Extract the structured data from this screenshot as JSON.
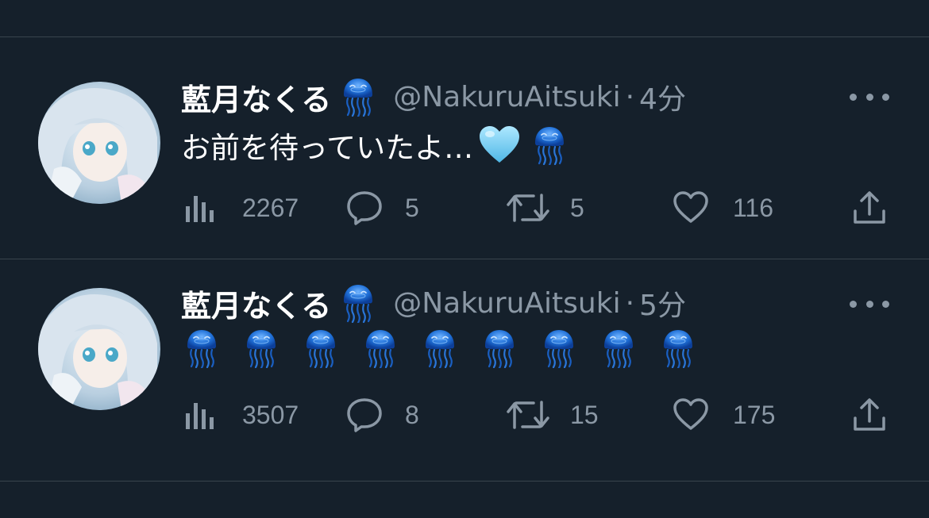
{
  "tweets": [
    {
      "display_name": "藍月なくる",
      "handle": "@NakuruAitsuki",
      "separator": "·",
      "time": "4分",
      "text": "お前を待っていたよ…",
      "text_emojis": [
        "light-blue-heart",
        "jellyfish"
      ],
      "stats": {
        "views": "2267",
        "replies": "5",
        "retweets": "5",
        "likes": "116"
      }
    },
    {
      "display_name": "藍月なくる",
      "handle": "@NakuruAitsuki",
      "separator": "·",
      "time": "5分",
      "text": "",
      "jellyfish_count": 9,
      "stats": {
        "views": "3507",
        "replies": "8",
        "retweets": "15",
        "likes": "175"
      }
    }
  ],
  "colors": {
    "background": "#15202b",
    "divider": "#38444d",
    "secondary_text": "#8b98a5",
    "primary_text": "#ffffff",
    "jellyfish": "#1f6fd6"
  }
}
